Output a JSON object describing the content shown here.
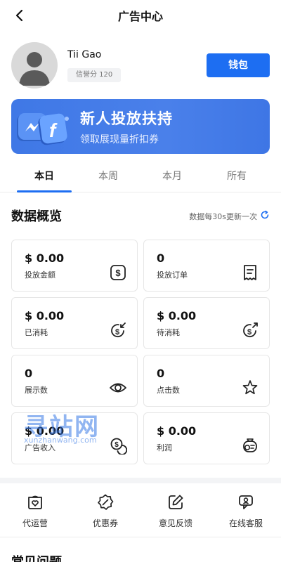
{
  "header": {
    "title": "广告中心",
    "back_icon": "chevron-left-icon"
  },
  "profile": {
    "name": "Tii Gao",
    "credit_label": "信誉分 120",
    "wallet_label": "钱包"
  },
  "banner": {
    "title": "新人投放扶持",
    "subtitle": "领取展现量折扣券",
    "illustration_icon": "messenger-facebook-icon"
  },
  "tabs": [
    {
      "label": "本日",
      "active": true
    },
    {
      "label": "本周",
      "active": false
    },
    {
      "label": "本月",
      "active": false
    },
    {
      "label": "所有",
      "active": false
    }
  ],
  "overview": {
    "title": "数据概览",
    "refresh_note": "数据每30s更新一次",
    "refresh_icon": "refresh-icon",
    "cards": [
      {
        "value": "$ 0.00",
        "label": "投放金额",
        "icon": "dollar-square-icon"
      },
      {
        "value": "0",
        "label": "投放订单",
        "icon": "receipt-icon"
      },
      {
        "value": "$ 0.00",
        "label": "已消耗",
        "icon": "dollar-in-icon"
      },
      {
        "value": "$ 0.00",
        "label": "待消耗",
        "icon": "dollar-out-icon"
      },
      {
        "value": "0",
        "label": "展示数",
        "icon": "eye-icon"
      },
      {
        "value": "0",
        "label": "点击数",
        "icon": "star-click-icon"
      },
      {
        "value": "$ 0.00",
        "label": "广告收入",
        "icon": "coins-icon"
      },
      {
        "value": "$ 0.00",
        "label": "利润",
        "icon": "money-bag-icon"
      }
    ]
  },
  "watermark": {
    "text": "寻站网",
    "url": "xunzhanwang.com"
  },
  "tools": [
    {
      "label": "代运营",
      "icon": "heart-box-icon"
    },
    {
      "label": "优惠券",
      "icon": "discount-badge-icon"
    },
    {
      "label": "意见反馈",
      "icon": "edit-square-icon"
    },
    {
      "label": "在线客服",
      "icon": "support-chat-icon"
    }
  ],
  "faq": {
    "title": "常见问题"
  },
  "colors": {
    "accent": "#1d6ef2",
    "banner": "#4a80ea"
  }
}
